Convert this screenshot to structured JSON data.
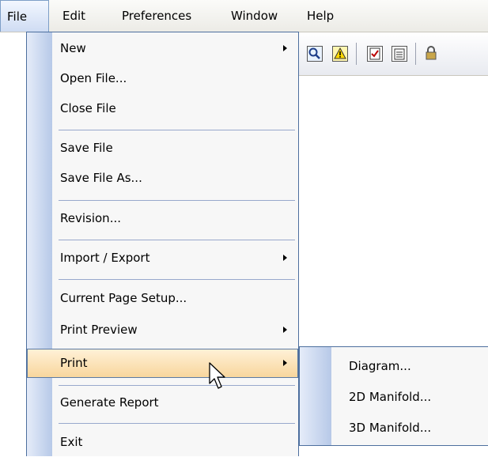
{
  "menubar": {
    "items": [
      {
        "label": "File"
      },
      {
        "label": "Edit"
      },
      {
        "label": "Preferences"
      },
      {
        "label": "Window"
      },
      {
        "label": "Help"
      }
    ]
  },
  "toolbar": {
    "icons": [
      "zoom-find-icon",
      "warning-icon",
      "checklist-icon",
      "report-icon",
      "lock-icon"
    ]
  },
  "file_menu": {
    "items": {
      "new": "New",
      "open_file": "Open File...",
      "close_file": "Close File",
      "save_file": "Save File",
      "save_file_as": "Save File As...",
      "revision": "Revision...",
      "import_export": "Import / Export",
      "current_page_setup": "Current Page Setup...",
      "print_preview": "Print Preview",
      "print": "Print",
      "generate_report": "Generate Report",
      "exit": "Exit"
    },
    "highlighted": "Print"
  },
  "print_submenu": {
    "items": {
      "diagram": "Diagram...",
      "manifold_2d": "2D Manifold...",
      "manifold_3d": "3D Manifold..."
    }
  },
  "colors": {
    "menu_border": "#4d6f9e",
    "gutter": "#b7c9e8",
    "hover": "#f8d69d",
    "separator": "#98a8cc"
  }
}
